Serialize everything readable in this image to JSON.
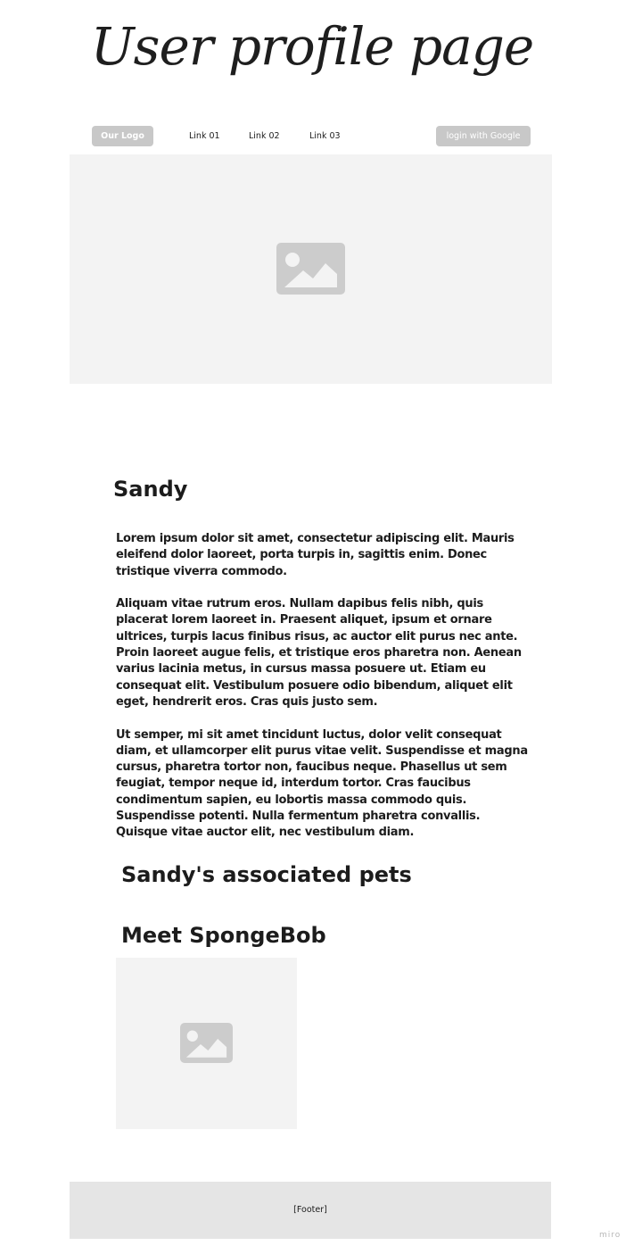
{
  "page": {
    "title": "User profile page"
  },
  "nav": {
    "logo_label": "Our Logo",
    "links": [
      "Link 01",
      "Link 02",
      "Link 03"
    ],
    "login_label": "login with Google"
  },
  "hero": {
    "image_icon": "image-placeholder-icon"
  },
  "profile": {
    "name": "Sandy",
    "bio": [
      "Lorem ipsum dolor sit amet, consectetur adipiscing elit. Mauris eleifend dolor laoreet, porta turpis in, sagittis enim. Donec tristique viverra commodo.",
      "Aliquam vitae rutrum eros. Nullam dapibus felis nibh, quis placerat lorem laoreet in. Praesent aliquet, ipsum et ornare ultrices, turpis lacus finibus risus, ac auctor elit purus nec ante. Proin laoreet augue felis, et tristique eros pharetra non. Aenean varius lacinia metus, in cursus massa posuere ut. Etiam eu consequat elit. Vestibulum posuere odio bibendum, aliquet elit eget, hendrerit eros. Cras quis justo sem.",
      "Ut semper, mi sit amet tincidunt luctus, dolor velit consequat diam, et ullamcorper elit purus vitae velit. Suspendisse et magna cursus, pharetra tortor non, faucibus neque. Phasellus ut sem feugiat, tempor neque id, interdum tortor. Cras faucibus condimentum sapien, eu lobortis massa commodo quis. Suspendisse potenti. Nulla fermentum pharetra convallis. Quisque vitae auctor elit, nec vestibulum diam."
    ]
  },
  "pets": {
    "heading": "Sandy's associated pets",
    "items": [
      {
        "title": "Meet SpongeBob",
        "image_icon": "image-placeholder-icon"
      }
    ]
  },
  "footer": {
    "label": "[Footer]"
  },
  "watermark": {
    "text": "miro"
  },
  "colors": {
    "placeholder_bg": "#f3f3f3",
    "placeholder_icon": "#cccccc",
    "button_bg": "#c8c8c8",
    "footer_bg": "#e5e5e5",
    "text": "#1c1c1c"
  }
}
